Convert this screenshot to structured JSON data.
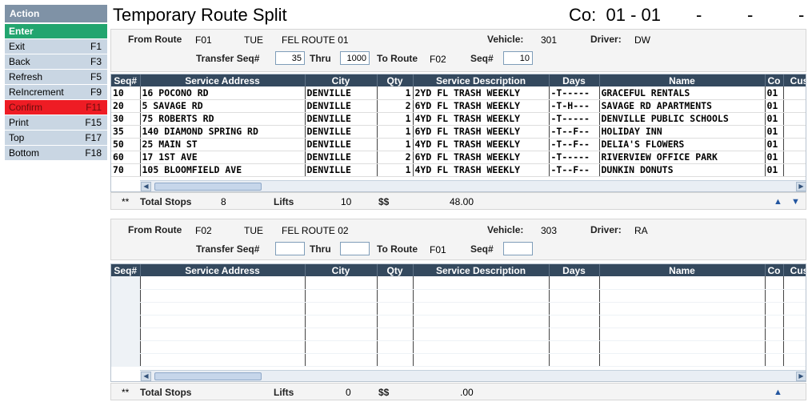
{
  "sidebar": {
    "header": "Action",
    "items": [
      {
        "label": "Enter",
        "key": ""
      },
      {
        "label": "Exit",
        "key": "F1"
      },
      {
        "label": "Back",
        "key": "F3"
      },
      {
        "label": "Refresh",
        "key": "F5"
      },
      {
        "label": "ReIncrement",
        "key": "F9"
      },
      {
        "label": "Confirm",
        "key": "F11"
      },
      {
        "label": "Print",
        "key": "F15"
      },
      {
        "label": "Top",
        "key": "F17"
      },
      {
        "label": "Bottom",
        "key": "F18"
      }
    ]
  },
  "header": {
    "title": "Temporary Route Split",
    "co_label": "Co:",
    "co_value": "01 - 01",
    "dashes": [
      "-",
      "-",
      "-"
    ]
  },
  "labels": {
    "from_route": "From Route",
    "vehicle": "Vehicle:",
    "driver": "Driver:",
    "transfer_seq": "Transfer Seq#",
    "thru": "Thru",
    "to_route": "To Route",
    "seq": "Seq#",
    "total_stops": "Total Stops",
    "lifts": "Lifts",
    "dollars": "$$",
    "stars": "**"
  },
  "columns": [
    "Seq#",
    "Service Address",
    "City",
    "Qty",
    "Service Description",
    "Days",
    "Name",
    "Co",
    "Cus"
  ],
  "panel1": {
    "route": "F01",
    "day": "TUE",
    "route_name": "FEL ROUTE 01",
    "vehicle": "301",
    "driver": "DW",
    "transfer_seq": "35",
    "thru": "1000",
    "to_route": "F02",
    "seq": "10",
    "rows": [
      {
        "seq": "10",
        "address": "16 POCONO RD",
        "city": "DENVILLE",
        "qty": "1",
        "desc": "2YD FL TRASH WEEKLY",
        "days": "-T-----",
        "name": "GRACEFUL RENTALS",
        "co": "01"
      },
      {
        "seq": "20",
        "address": "5 SAVAGE RD",
        "city": "DENVILLE",
        "qty": "2",
        "desc": "6YD FL TRASH WEEKLY",
        "days": "-T-H---",
        "name": "SAVAGE RD APARTMENTS",
        "co": "01"
      },
      {
        "seq": "30",
        "address": "75 ROBERTS RD",
        "city": "DENVILLE",
        "qty": "1",
        "desc": "4YD FL TRASH WEEKLY",
        "days": "-T-----",
        "name": "DENVILLE PUBLIC SCHOOLS",
        "co": "01"
      },
      {
        "seq": "35",
        "address": "140 DIAMOND SPRING RD",
        "city": "DENVILLE",
        "qty": "1",
        "desc": "6YD FL TRASH WEEKLY",
        "days": "-T--F--",
        "name": "HOLIDAY INN",
        "co": "01"
      },
      {
        "seq": "50",
        "address": "25 MAIN ST",
        "city": "DENVILLE",
        "qty": "1",
        "desc": "4YD FL TRASH WEEKLY",
        "days": "-T--F--",
        "name": "DELIA'S FLOWERS",
        "co": "01"
      },
      {
        "seq": "60",
        "address": "17 1ST AVE",
        "city": "DENVILLE",
        "qty": "2",
        "desc": "6YD FL TRASH WEEKLY",
        "days": "-T-----",
        "name": "RIVERVIEW OFFICE PARK",
        "co": "01"
      },
      {
        "seq": "70",
        "address": "105 BLOOMFIELD AVE",
        "city": "DENVILLE",
        "qty": "1",
        "desc": "4YD FL TRASH WEEKLY",
        "days": "-T--F--",
        "name": "DUNKIN DONUTS",
        "co": "01"
      }
    ],
    "total_stops": "8",
    "lifts": "10",
    "dollars": "48.00"
  },
  "panel2": {
    "route": "F02",
    "day": "TUE",
    "route_name": "FEL ROUTE 02",
    "vehicle": "303",
    "driver": "RA",
    "transfer_seq": "",
    "thru": "",
    "to_route": "F01",
    "seq": "",
    "total_stops": "",
    "lifts": "0",
    "dollars": ".00"
  }
}
